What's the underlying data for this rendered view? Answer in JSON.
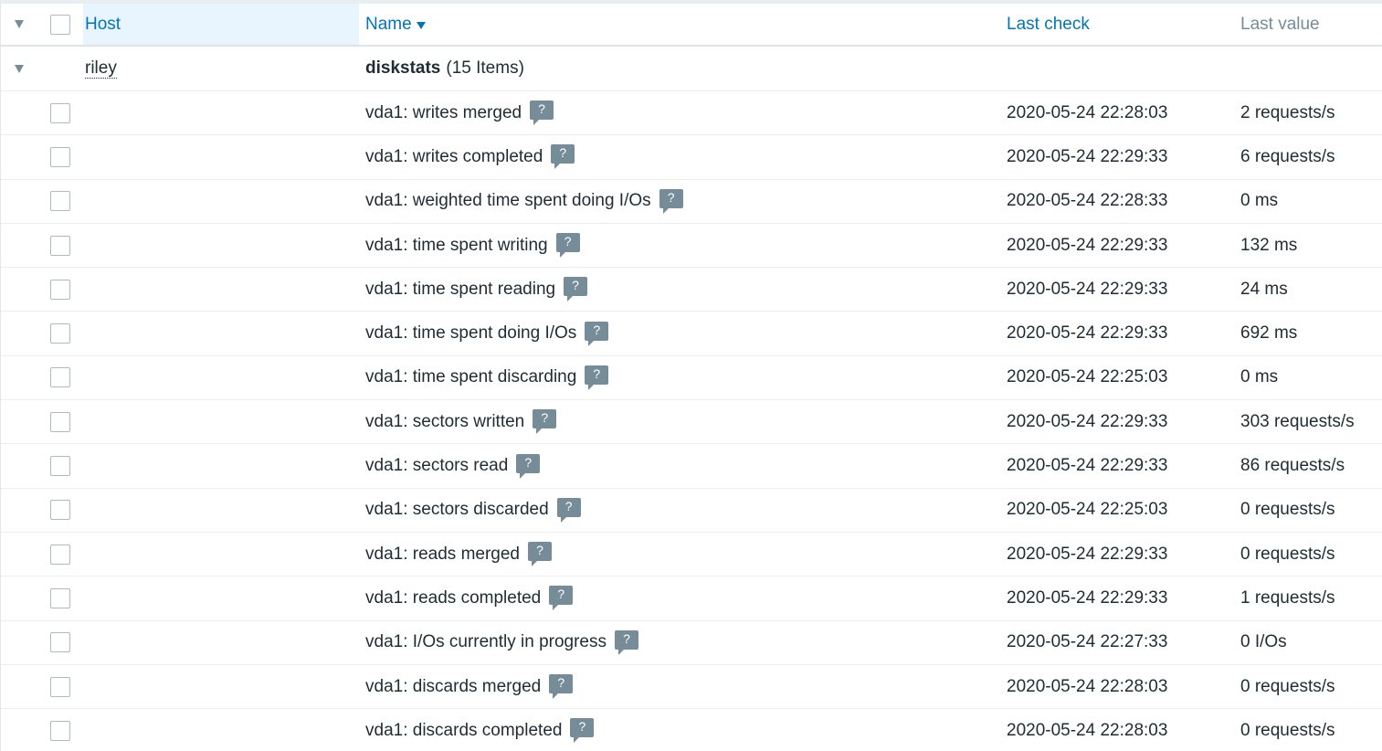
{
  "header": {
    "host_label": "Host",
    "name_label": "Name",
    "last_check_label": "Last check",
    "last_value_label": "Last value"
  },
  "group": {
    "host": "riley",
    "title": "diskstats",
    "count": "(15 Items)"
  },
  "hint_glyph": "?",
  "items": [
    {
      "name": "vda1: writes merged",
      "last_check": "2020-05-24 22:28:03",
      "last_value": "2 requests/s"
    },
    {
      "name": "vda1: writes completed",
      "last_check": "2020-05-24 22:29:33",
      "last_value": "6 requests/s"
    },
    {
      "name": "vda1: weighted time spent doing I/Os",
      "last_check": "2020-05-24 22:28:33",
      "last_value": "0 ms"
    },
    {
      "name": "vda1: time spent writing",
      "last_check": "2020-05-24 22:29:33",
      "last_value": "132 ms"
    },
    {
      "name": "vda1: time spent reading",
      "last_check": "2020-05-24 22:29:33",
      "last_value": "24 ms"
    },
    {
      "name": "vda1: time spent doing I/Os",
      "last_check": "2020-05-24 22:29:33",
      "last_value": "692 ms"
    },
    {
      "name": "vda1: time spent discarding",
      "last_check": "2020-05-24 22:25:03",
      "last_value": "0 ms"
    },
    {
      "name": "vda1: sectors written",
      "last_check": "2020-05-24 22:29:33",
      "last_value": "303 requests/s"
    },
    {
      "name": "vda1: sectors read",
      "last_check": "2020-05-24 22:29:33",
      "last_value": "86 requests/s"
    },
    {
      "name": "vda1: sectors discarded",
      "last_check": "2020-05-24 22:25:03",
      "last_value": "0 requests/s"
    },
    {
      "name": "vda1: reads merged",
      "last_check": "2020-05-24 22:29:33",
      "last_value": "0 requests/s"
    },
    {
      "name": "vda1: reads completed",
      "last_check": "2020-05-24 22:29:33",
      "last_value": "1 requests/s"
    },
    {
      "name": "vda1: I/Os currently in progress",
      "last_check": "2020-05-24 22:27:33",
      "last_value": "0 I/Os"
    },
    {
      "name": "vda1: discards merged",
      "last_check": "2020-05-24 22:28:03",
      "last_value": "0 requests/s"
    },
    {
      "name": "vda1: discards completed",
      "last_check": "2020-05-24 22:28:03",
      "last_value": "0 requests/s"
    }
  ]
}
